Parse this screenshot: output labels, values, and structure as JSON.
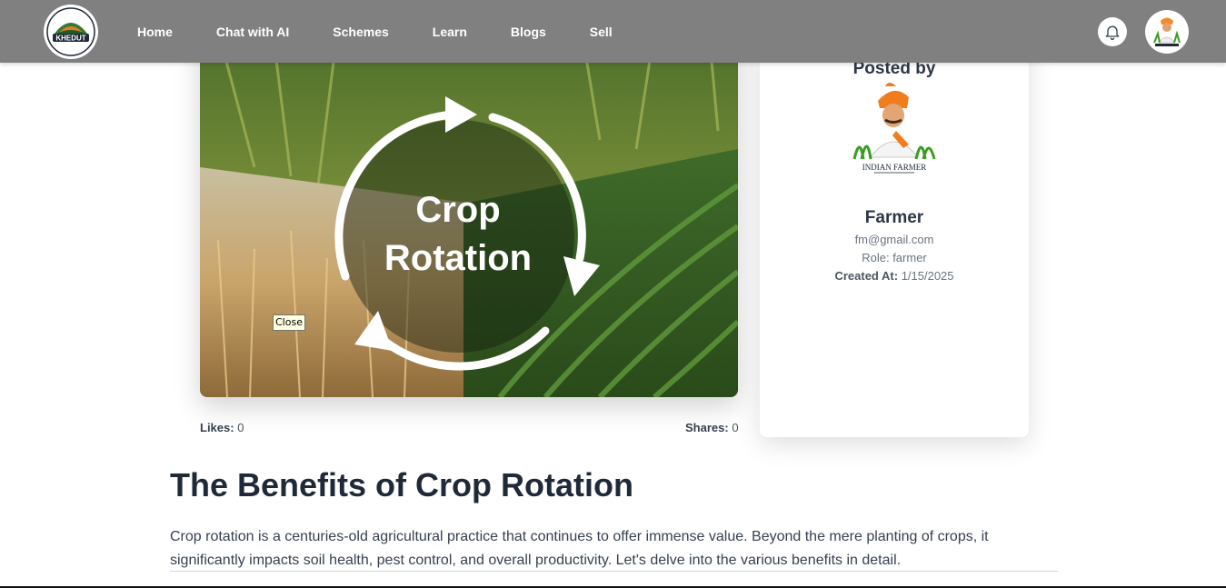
{
  "nav": {
    "logo_text": "KHEDUT",
    "links": [
      "Home",
      "Chat with AI",
      "Schemes",
      "Learn",
      "Blogs",
      "Sell"
    ]
  },
  "hero": {
    "image_text_line1": "Crop",
    "image_text_line2": "Rotation",
    "tooltip": "Close"
  },
  "stats": {
    "likes_label": "Likes:",
    "likes_value": "0",
    "shares_label": "Shares:",
    "shares_value": "0"
  },
  "author": {
    "heading": "Posted by",
    "image_caption": "INDIAN FARMER",
    "name": "Farmer",
    "email": "fm@gmail.com",
    "role": "Role: farmer",
    "created_label": "Created At:",
    "created_value": "1/15/2025"
  },
  "article": {
    "title": "The Benefits of Crop Rotation",
    "intro": "Crop rotation is a centuries-old agricultural practice that continues to offer immense value. Beyond the mere planting of crops, it significantly impacts soil health, pest control, and overall productivity. Let's delve into the various benefits in detail."
  },
  "colors": {
    "navbar": "#808080",
    "text_dark": "#1f2937",
    "text_muted": "#6b7280"
  }
}
